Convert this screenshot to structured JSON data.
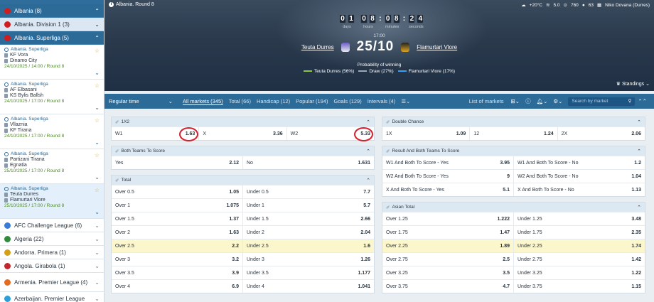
{
  "sidebar": {
    "albania": {
      "label": "Albania (8)"
    },
    "division1": {
      "label": "Albania. Division 1 (3)"
    },
    "superliga": {
      "label": "Albania. Superliga (5)"
    },
    "matches": [
      {
        "league": "Albania. Superliga",
        "team1": "KF Vora",
        "team2": "Dinamo City",
        "time": "24/10/2025 / 14:00 / Round 8"
      },
      {
        "league": "Albania. Superliga",
        "team1": "AF Elbasani",
        "team2": "KS Bylis Ballsh",
        "time": "24/10/2025 / 17:00 / Round 8"
      },
      {
        "league": "Albania. Superliga",
        "team1": "Vllaznia",
        "team2": "KF Tirana",
        "time": "24/10/2025 / 17:00 / Round 8"
      },
      {
        "league": "Albania. Superliga",
        "team1": "Partizani Tirana",
        "team2": "Egnatia",
        "time": "25/10/2025 / 17:00 / Round 8"
      },
      {
        "league": "Albania. Superliga",
        "team1": "Teuta Durres",
        "team2": "Flamurtari Vlore",
        "time": "25/10/2025 / 17:00 / Round 8"
      }
    ],
    "leagues": [
      {
        "label": "AFC Challenge League (6)",
        "color": "#3a7bd5"
      },
      {
        "label": "Algeria (22)",
        "color": "#2e8b3c"
      },
      {
        "label": "Andorra. Primera (1)",
        "color": "#d4a017"
      },
      {
        "label": "Angola. Girabola (1)",
        "color": "#c0282d"
      },
      {
        "label": "Armenia. Premier League (4)",
        "color": "#e36b1f"
      },
      {
        "label": "Azerbaijan. Premier League",
        "color": "#2aa0d8"
      }
    ]
  },
  "hero": {
    "round": "Albania. Round 8",
    "weather": {
      "temp": "+20°C",
      "wind": "5.0",
      "humidity": "760",
      "rain": "63",
      "stadium": "Niko Dovana (Durres)"
    },
    "timer": {
      "days": "01",
      "hours": "08",
      "minutes": "08",
      "seconds": "24",
      "labels": [
        "days",
        "hours",
        "minutes",
        "seconds"
      ]
    },
    "kickoff": "17:00",
    "home": "Teuta Durres",
    "away": "Flamurtari Vlore",
    "score": "25/10",
    "prob_title": "Probability of winning",
    "prob": [
      {
        "label": "Teuta Durres (56%)",
        "color": "#8cc63f"
      },
      {
        "label": "Draw (27%)",
        "color": "#9aa7b4"
      },
      {
        "label": "Flamurtari Vlore (17%)",
        "color": "#3a9df0"
      }
    ],
    "standings": "Standings"
  },
  "tabs": {
    "regular": "Regular time",
    "items": [
      {
        "label": "All markets (345)",
        "active": true
      },
      {
        "label": "Total (66)"
      },
      {
        "label": "Handicap (12)"
      },
      {
        "label": "Popular (194)"
      },
      {
        "label": "Goals (129)"
      },
      {
        "label": "Intervals (4)"
      }
    ],
    "list": "List of markets",
    "search": "Search by market"
  },
  "markets": {
    "left": [
      {
        "title": "1X2",
        "rows": [
          [
            [
              "W1",
              "1.63"
            ],
            [
              "X",
              "3.36"
            ],
            [
              "W2",
              "5.33"
            ]
          ]
        ]
      },
      {
        "title": "Both Teams To Score",
        "rows": [
          [
            [
              "Yes",
              "2.12"
            ],
            [
              "No",
              "1.631"
            ]
          ]
        ]
      },
      {
        "title": "Total",
        "rows": [
          [
            [
              "Over 0.5",
              "1.05"
            ],
            [
              "Under 0.5",
              "7.7"
            ]
          ],
          [
            [
              "Over 1",
              "1.075"
            ],
            [
              "Under 1",
              "5.7"
            ]
          ],
          [
            [
              "Over 1.5",
              "1.37"
            ],
            [
              "Under 1.5",
              "2.66"
            ]
          ],
          [
            [
              "Over 2",
              "1.63"
            ],
            [
              "Under 2",
              "2.04"
            ]
          ],
          [
            [
              "Over 2.5",
              "2.2"
            ],
            [
              "Under 2.5",
              "1.6"
            ]
          ],
          [
            [
              "Over 3",
              "3.2"
            ],
            [
              "Under 3",
              "1.26"
            ]
          ],
          [
            [
              "Over 3.5",
              "3.9"
            ],
            [
              "Under 3.5",
              "1.177"
            ]
          ],
          [
            [
              "Over 4",
              "6.9"
            ],
            [
              "Under 4",
              "1.041"
            ]
          ]
        ]
      }
    ],
    "right": [
      {
        "title": "Double Chance",
        "rows": [
          [
            [
              "1X",
              "1.09"
            ],
            [
              "12",
              "1.24"
            ],
            [
              "2X",
              "2.06"
            ]
          ]
        ]
      },
      {
        "title": "Result And Both Teams To Score",
        "rows": [
          [
            [
              "W1 And Both To Score - Yes",
              "3.95"
            ],
            [
              "W1 And Both To Score - No",
              "1.2"
            ]
          ],
          [
            [
              "W2 And Both To Score - Yes",
              "9"
            ],
            [
              "W2 And Both To Score - No",
              "1.04"
            ]
          ],
          [
            [
              "X And Both To Score - Yes",
              "5.1"
            ],
            [
              "X And Both To Score - No",
              "1.13"
            ]
          ]
        ]
      },
      {
        "title": "Asian Total",
        "rows": [
          [
            [
              "Over 1.25",
              "1.222"
            ],
            [
              "Under 1.25",
              "3.48"
            ]
          ],
          [
            [
              "Over 1.75",
              "1.47"
            ],
            [
              "Under 1.75",
              "2.35"
            ]
          ],
          [
            [
              "Over 2.25",
              "1.89"
            ],
            [
              "Under 2.25",
              "1.74"
            ]
          ],
          [
            [
              "Over 2.75",
              "2.5"
            ],
            [
              "Under 2.75",
              "1.42"
            ]
          ],
          [
            [
              "Over 3.25",
              "3.5"
            ],
            [
              "Under 3.25",
              "1.22"
            ]
          ],
          [
            [
              "Over 3.75",
              "4.7"
            ],
            [
              "Under 3.75",
              "1.15"
            ]
          ]
        ]
      }
    ]
  }
}
